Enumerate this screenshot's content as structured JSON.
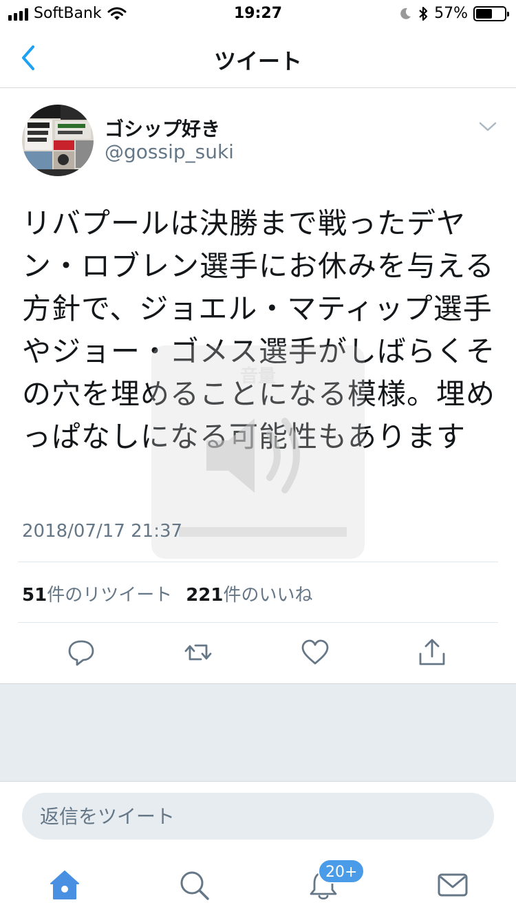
{
  "status_bar": {
    "carrier": "SoftBank",
    "time": "19:27",
    "battery_percent": "57%",
    "battery_level": 0.57
  },
  "nav": {
    "title": "ツイート"
  },
  "tweet": {
    "author_name": "ゴシップ好き",
    "author_handle": "@gossip_suki",
    "text": "リバプールは決勝まで戦ったデヤン・ロブレン選手にお休みを与える方針で、ジョエル・マティップ選手やジョー・ゴメス選手がしばらくその穴を埋めることになる模様。埋めっぱなしになる可能性もあります",
    "timestamp": "2018/07/17 21:37",
    "retweet_count": "51",
    "retweet_label": "件のリツイート",
    "like_count": "221",
    "like_label": "件のいいね"
  },
  "volume_hud": {
    "title": "音量"
  },
  "reply": {
    "placeholder": "返信をツイート"
  },
  "tab_bar": {
    "notification_badge": "20+"
  },
  "colors": {
    "accent": "#1da1f2",
    "tab_active": "#4a90e2",
    "secondary_text": "#657786",
    "divider": "#e1e8ed",
    "gray_background": "#e6ecf0"
  },
  "icons": {
    "back": "chevron-left-icon",
    "caret": "chevron-down-icon",
    "reply": "reply-icon",
    "retweet": "retweet-icon",
    "like": "heart-icon",
    "share": "share-icon",
    "home": "home-icon",
    "search": "search-icon",
    "notifications": "bell-icon",
    "messages": "envelope-icon",
    "speaker": "speaker-icon"
  }
}
